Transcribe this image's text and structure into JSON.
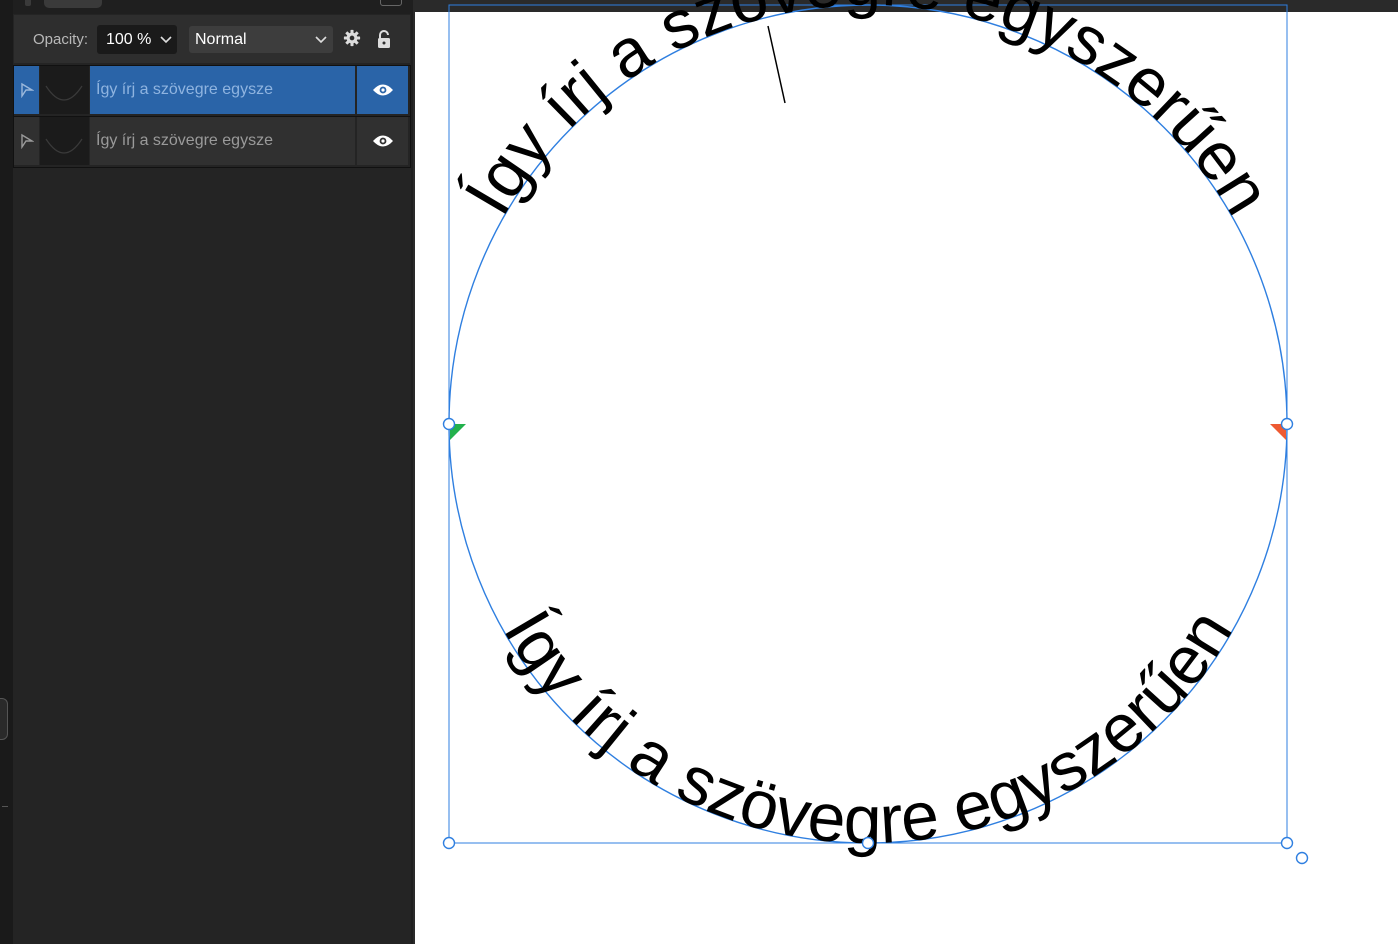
{
  "layers_panel": {
    "opacity_label": "Opacity:",
    "opacity_value": "100 %",
    "blend_mode": "Normal",
    "layers": [
      {
        "name": "Így írj a szövegre egysze",
        "selected": true,
        "visible": true,
        "type_icon": "path-text-icon"
      },
      {
        "name": "Így írj a szövegre egysze",
        "selected": false,
        "visible": true,
        "type_icon": "path-text-icon"
      }
    ]
  },
  "canvas": {
    "top_text": "Így írj a szövegre egyszerűen",
    "bottom_text": "Így írj a szövegre egyszerűen",
    "colors": {
      "selection": "#2f7fe0",
      "start_handle": "#22b14c",
      "end_handle": "#ee5a32",
      "text": "#000000"
    }
  }
}
